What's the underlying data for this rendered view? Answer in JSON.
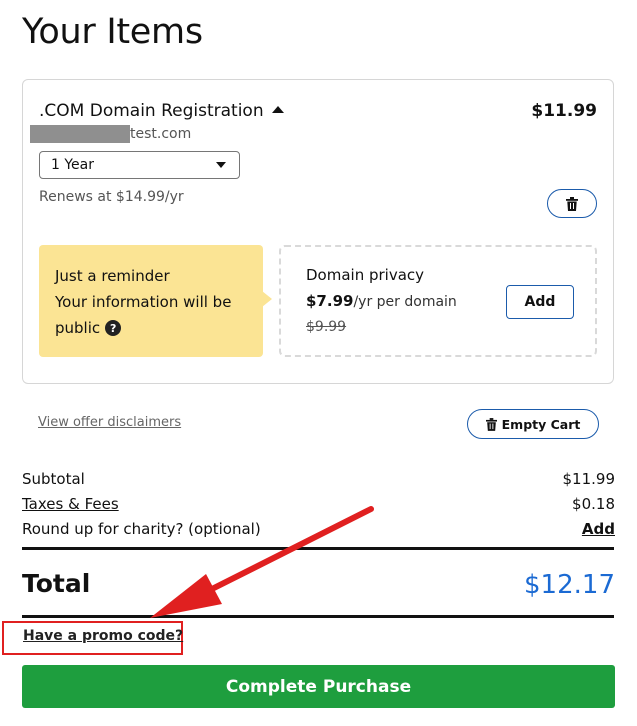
{
  "page": {
    "title": "Your Items"
  },
  "item": {
    "name": ".COM Domain Registration",
    "price": "$11.99",
    "domain_suffix": "test.com",
    "term": {
      "selected": "1 Year"
    },
    "renews": "Renews at $14.99/yr"
  },
  "reminder": {
    "title": "Just a reminder",
    "line1": "Your information will be",
    "line2": "public"
  },
  "privacy": {
    "title": "Domain privacy",
    "price": "$7.99",
    "price_suffix": "/yr per domain",
    "old_price": "$9.99",
    "add_label": "Add"
  },
  "links": {
    "disclaimers": "View offer disclaimers",
    "promo": "Have a promo code?"
  },
  "cart": {
    "empty_label": "Empty Cart"
  },
  "summary": {
    "subtotal_label": "Subtotal",
    "subtotal_value": "$11.99",
    "taxes_label": "Taxes & Fees",
    "taxes_value": "$0.18",
    "charity_label": "Round up for charity? (optional)",
    "charity_action": "Add",
    "total_label": "Total",
    "total_value": "$12.17"
  },
  "checkout": {
    "button_label": "Complete Purchase"
  },
  "icons": {
    "trash": "trash-icon",
    "help": "help-circle-icon",
    "caret_up": "caret-up-icon",
    "caret_down": "caret-down-icon"
  },
  "colors": {
    "accent_blue": "#1b5bab",
    "total_blue": "#1b6ad3",
    "checkout_green": "#1e9e3e",
    "reminder_yellow": "#fbe494",
    "annotation_red": "#e02020"
  }
}
